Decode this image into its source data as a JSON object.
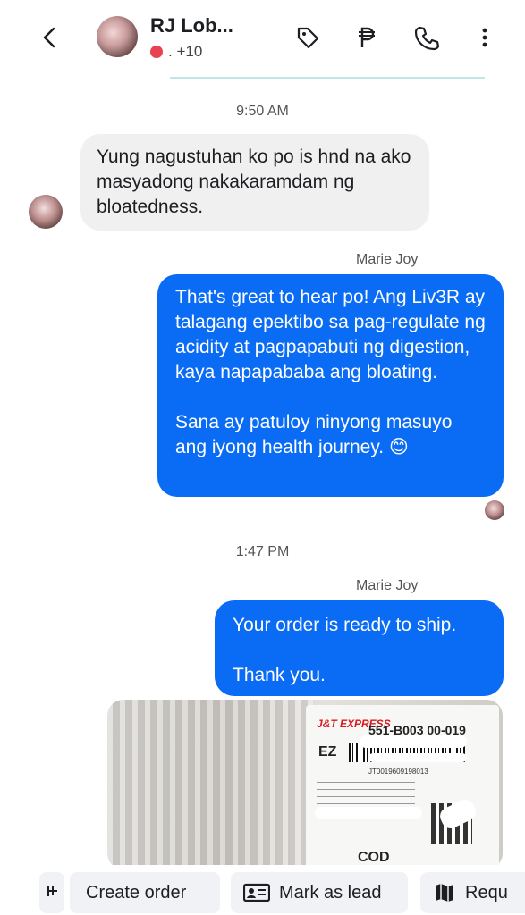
{
  "header": {
    "contact_name": "RJ Lob...",
    "participants": ". +10",
    "status_color": "#e8414f",
    "icons": [
      "back-icon",
      "tag-icon",
      "peso-icon",
      "phone-icon",
      "more-icon"
    ]
  },
  "messages": [
    {
      "type": "timestamp",
      "text": "9:50 AM"
    },
    {
      "type": "incoming",
      "text": "Yung nagustuhan ko po is hnd na ako masyadong nakakaramdam ng bloatedness."
    },
    {
      "type": "sender",
      "text": "Marie Joy"
    },
    {
      "type": "outgoing",
      "paragraph1": "That's great to hear po! Ang Liv3R ay talagang epektibo sa pag-regulate ng acidity at pagpapabuti ng digestion, kaya napapababa ang bloating.",
      "paragraph2": "Sana ay patuloy ninyong masuyo ang iyong health journey. 😊"
    },
    {
      "type": "timestamp",
      "text": "1:47 PM"
    },
    {
      "type": "sender",
      "text": "Marie Joy"
    },
    {
      "type": "outgoing",
      "paragraph1": "Your order is ready to ship.",
      "paragraph2": "Thank you."
    }
  ],
  "photo": {
    "courier": "J&T EXPRESS",
    "tracking": "551-B003 00-019",
    "code": "EZ",
    "waybill": "JT0019609198013",
    "payment": "COD"
  },
  "actions": [
    {
      "label": "Create order",
      "icon": "create-order-icon"
    },
    {
      "label": "Mark as lead",
      "icon": "lead-card-icon"
    },
    {
      "label": "Requ",
      "icon": "map-icon"
    }
  ],
  "colors": {
    "outgoing_bubble": "#0a6cf5",
    "incoming_bubble": "#f0f0f0",
    "accent_strip": "#bfe6ea"
  }
}
